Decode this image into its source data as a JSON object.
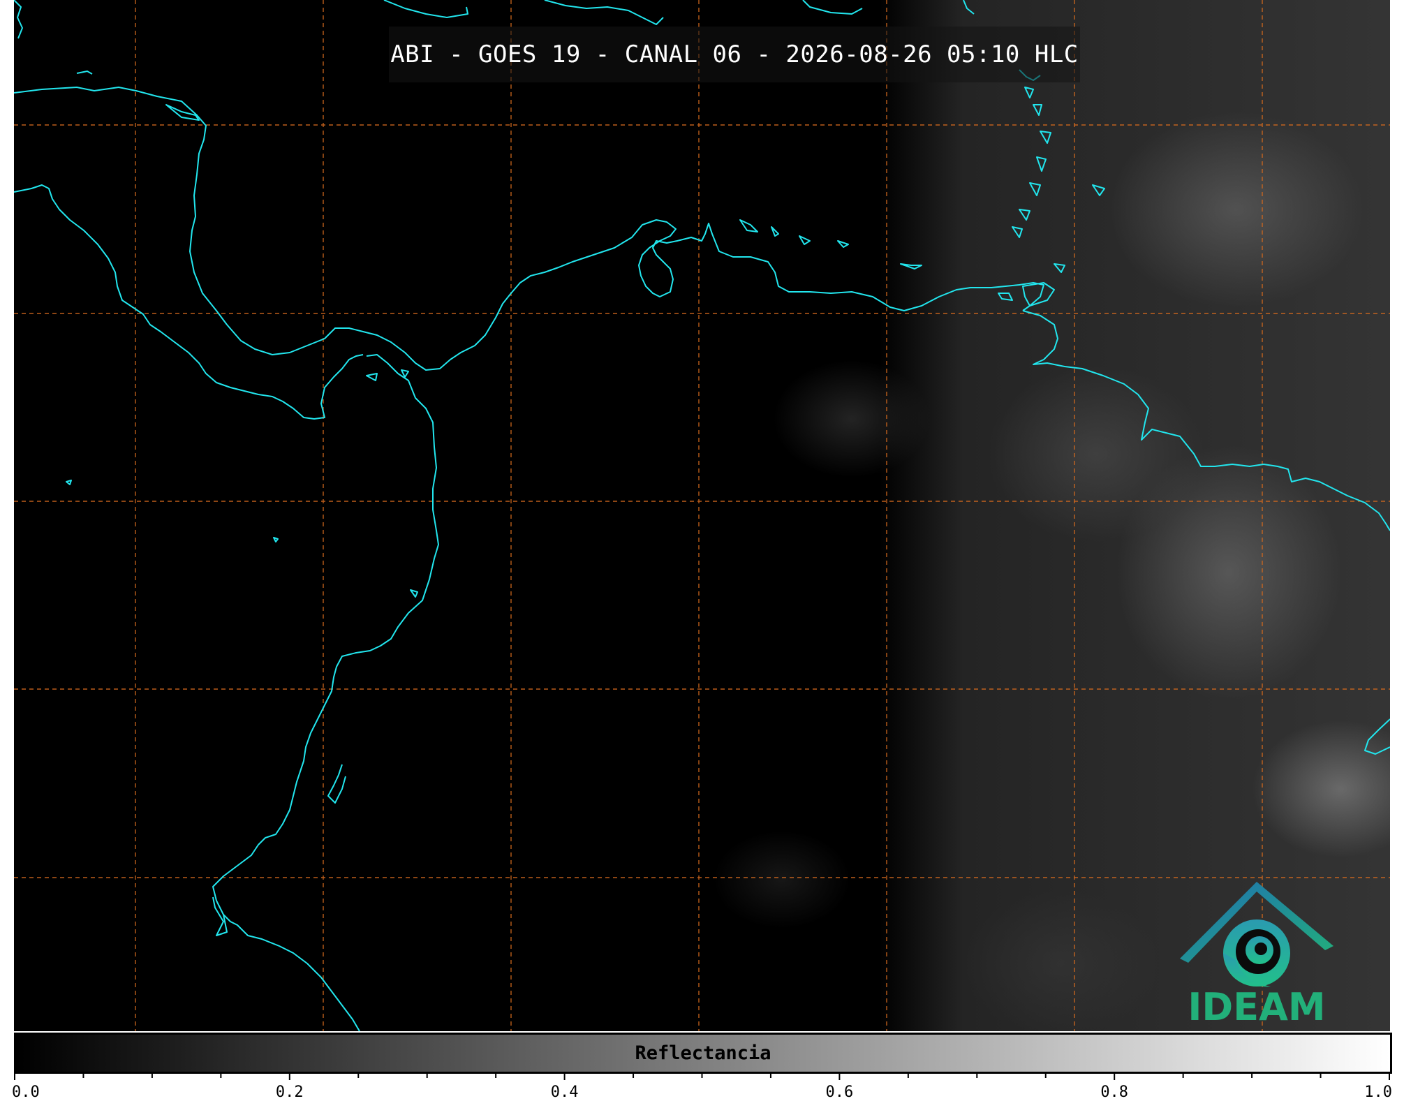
{
  "title": "ABI - GOES 19 - CANAL 06 - 2026-08-26 05:10 HLC",
  "colorbar": {
    "label": "Reflectancia",
    "min": 0.0,
    "max": 1.0,
    "colormap": "gray",
    "tick_labels": [
      "0.0",
      "0.2",
      "0.4",
      "0.6",
      "0.8",
      "1.0"
    ],
    "tick_values": [
      0.0,
      0.2,
      0.4,
      0.6,
      0.8,
      1.0
    ],
    "minor_step": 0.05
  },
  "logo": {
    "text": "IDEAM"
  },
  "colors": {
    "background": "#000000",
    "coastline": "#22e6ee",
    "gridline": "#d2691e",
    "logo_green": "#22b07a",
    "logo_blue": "#1f6fb2"
  },
  "map": {
    "gridlines": "dashed",
    "coastlines": true
  }
}
